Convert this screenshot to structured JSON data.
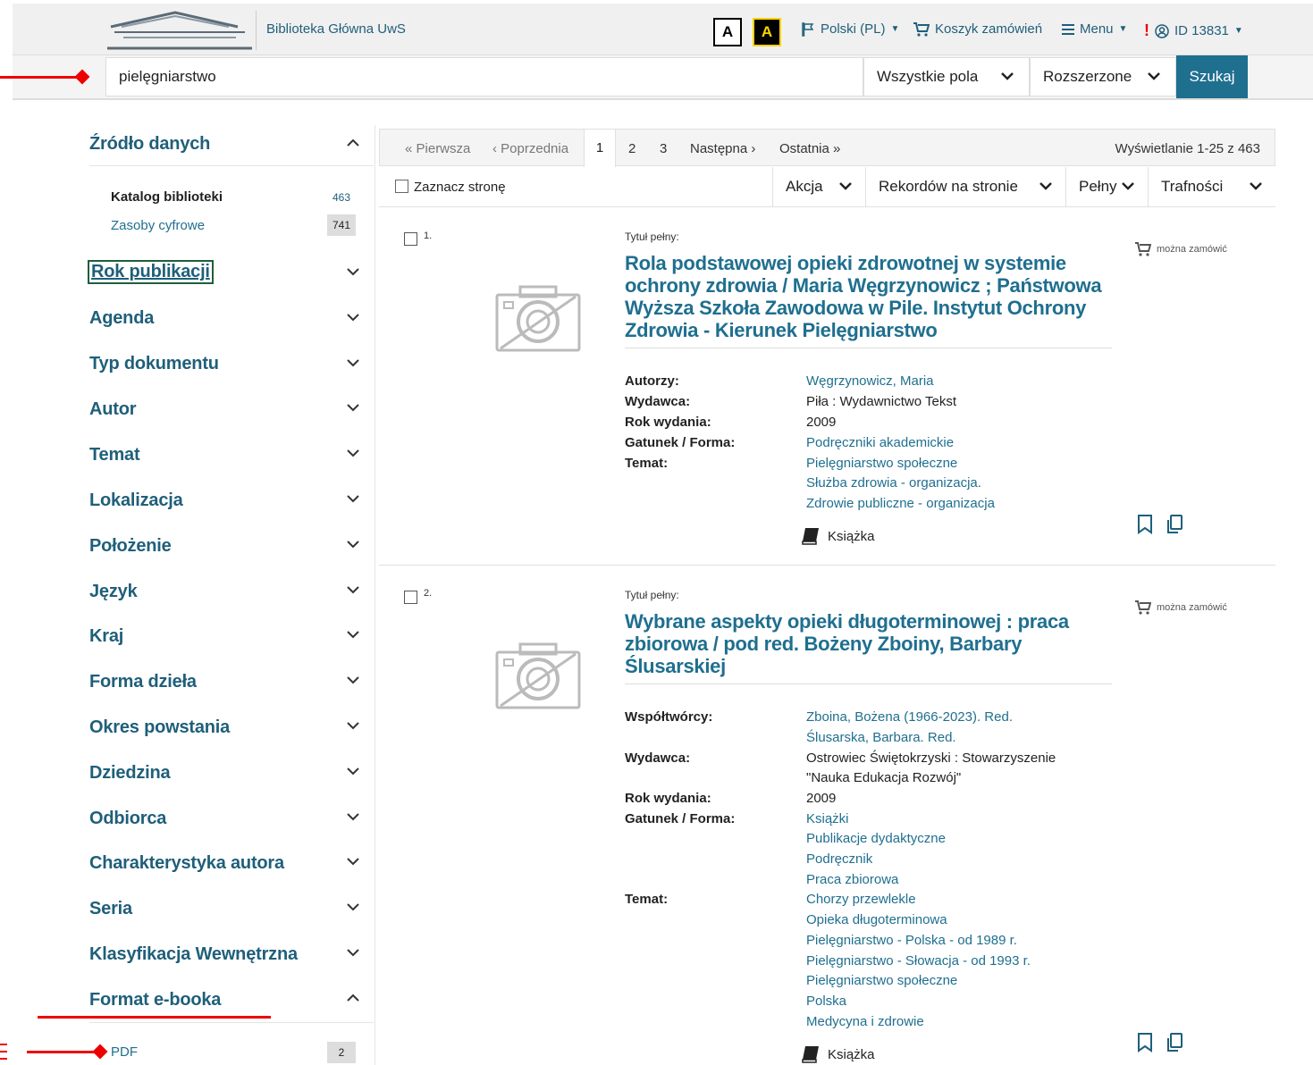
{
  "header": {
    "library_name": "Biblioteka Główna UwS",
    "contrast_normal": "A",
    "contrast_high": "A",
    "language": "Polski (PL)",
    "cart": "Koszyk zamówień",
    "menu": "Menu",
    "user": "ID 13831"
  },
  "search": {
    "query": "pielęgniarstwo",
    "field": "Wszystkie pola",
    "mode": "Rozszerzone",
    "button": "Szukaj"
  },
  "sidebar": {
    "source_title": "Źródło danych",
    "sources": [
      {
        "label": "Katalog biblioteki",
        "count": "463"
      },
      {
        "label": "Zasoby cyfrowe",
        "count": "741"
      }
    ],
    "facets": [
      "Rok publikacji",
      "Agenda",
      "Typ dokumentu",
      "Autor",
      "Temat",
      "Lokalizacja",
      "Położenie",
      "Język",
      "Kraj",
      "Forma dzieła",
      "Okres powstania",
      "Dziedzina",
      "Odbiorca",
      "Charakterystyka autora",
      "Seria",
      "Klasyfikacja Wewnętrzna",
      "Format e-booka"
    ],
    "ebook_items": [
      {
        "label": "PDF",
        "count": "2"
      }
    ]
  },
  "pager": {
    "first": "« Pierwsza",
    "prev": "‹ Poprzednia",
    "pages": [
      "1",
      "2",
      "3"
    ],
    "next": "Następna ›",
    "last": "Ostatnia »",
    "showing": "Wyświetlanie 1-25 z 463"
  },
  "toolbar": {
    "select_page": "Zaznacz stronę",
    "action": "Akcja",
    "per_page": "Rekordów na stronie",
    "view": "Pełny",
    "sort": "Trafności"
  },
  "records": [
    {
      "num": "1.",
      "title_prefix": "Tytuł pełny:",
      "title": [
        "Rola podstawowej opieki zdrowotnej w systemie",
        "ochrony zdrowia / Maria Węgrzynowicz ; Państwowa",
        "Wyższa Szkoła Zawodowa w Pile. Instytut Ochrony",
        "Zdrowia - Kierunek Pielęgniarstwo"
      ],
      "labels": {
        "a": "Autorzy:",
        "b": "Wydawca:",
        "c": "Rok wydania:",
        "d": "Gatunek / Forma:",
        "e": "Temat:"
      },
      "author": "Węgrzynowicz, Maria",
      "publisher": "Piła : Wydawnictwo Tekst",
      "year": "2009",
      "genre": "Podręczniki akademickie",
      "subjects": [
        "Pielęgniarstwo społeczne",
        "Służba zdrowia - organizacja.",
        "Zdrowie publiczne - organizacja"
      ],
      "doctype": "Książka",
      "order": "można zamówić"
    },
    {
      "num": "2.",
      "title_prefix": "Tytuł pełny:",
      "title": [
        "Wybrane aspekty opieki długoterminowej : praca",
        "zbiorowa / pod red. Bożeny Zboiny, Barbary",
        "Ślusarskiej"
      ],
      "labels": {
        "a": "Współtwórcy:",
        "b": "Wydawca:",
        "c": "Rok wydania:",
        "d": "Gatunek / Forma:",
        "e": "Temat:"
      },
      "contributors": [
        "Zboina, Bożena (1966-2023). Red.",
        "Ślusarska, Barbara. Red."
      ],
      "publisher": [
        "Ostrowiec Świętokrzyski : Stowarzyszenie",
        "\"Nauka Edukacja Rozwój\""
      ],
      "year": "2009",
      "genres": [
        "Książki",
        "Publikacje dydaktyczne",
        "Podręcznik",
        "Praca zbiorowa"
      ],
      "subjects": [
        "Chorzy przewlekle",
        "Opieka długoterminowa",
        "Pielęgniarstwo - Polska - od 1989 r.",
        "Pielęgniarstwo - Słowacja - od 1993 r.",
        "Pielęgniarstwo społeczne",
        "Polska",
        "Medycyna i zdrowie"
      ],
      "doctype": "Książka",
      "order": "można zamówić"
    }
  ],
  "colors": {
    "brand": "#1f6f8f",
    "annotation": "#e00000"
  }
}
